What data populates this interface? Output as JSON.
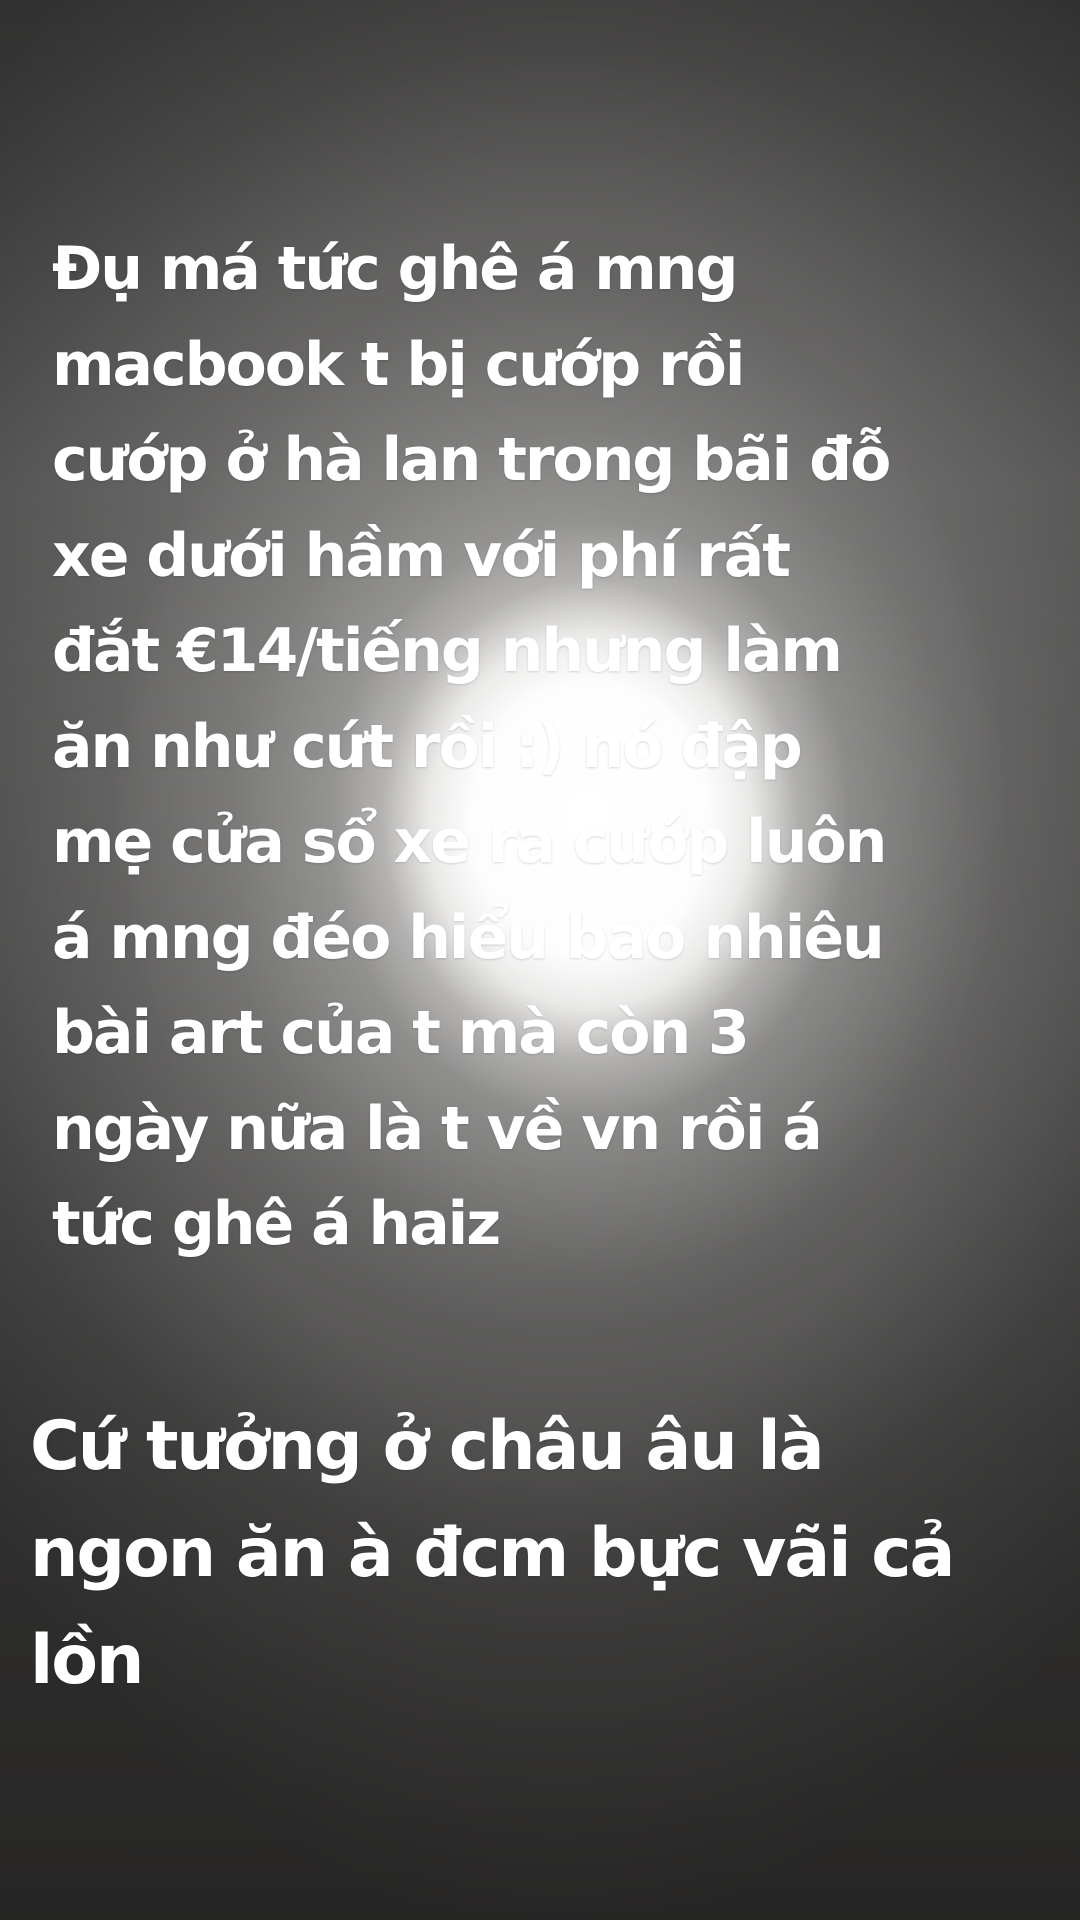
{
  "story": {
    "caption_1": "Đụ má tức ghê á mng\nmacbook t bị cướp rồi\ncướp ở hà lan trong bãi đỗ\nxe dưới hầm với phí rất\nđắt €14/tiếng nhưng làm\năn như cứt rồi :) nó đập\nmẹ cửa sổ xe ra cướp luôn\ná mng đéo hiểu bao nhiêu\nbài art của t mà còn 3\nngày nữa là t về vn rồi á\ntức ghê á haiz",
    "caption_2": "Cứ tưởng ở châu âu là\nngon ăn à đcm bực vãi cả\nlồn"
  }
}
